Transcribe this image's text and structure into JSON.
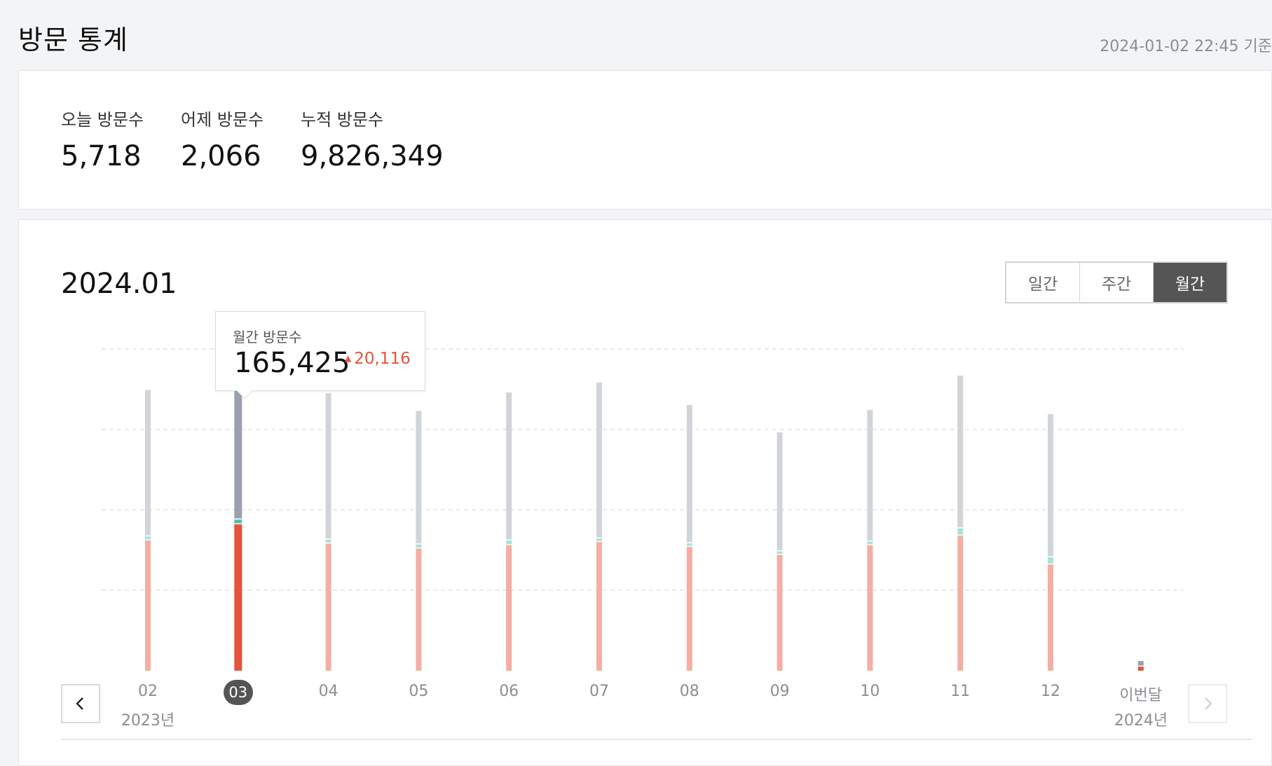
{
  "header": {
    "title": "방문 통계",
    "timestamp": "2024-01-02 22:45 기준"
  },
  "summary": [
    {
      "label": "오늘 방문수",
      "value": "5,718"
    },
    {
      "label": "어제 방문수",
      "value": "2,066"
    },
    {
      "label": "누적 방문수",
      "value": "9,826,349"
    }
  ],
  "chart_panel": {
    "period": "2024.01",
    "tabs": [
      {
        "label": "일간",
        "active": false
      },
      {
        "label": "주간",
        "active": false
      },
      {
        "label": "월간",
        "active": true
      }
    ],
    "tooltip": {
      "label": "월간 방문수",
      "value": "165,425",
      "delta": "20,116",
      "delta_direction": "up"
    },
    "year_labels": {
      "left": "2023년",
      "right": "2024년"
    },
    "prev_icon": "chevron-left-icon",
    "next_icon": "chevron-right-icon"
  },
  "chart_data": {
    "type": "bar",
    "stacked": true,
    "categories": [
      "02",
      "03",
      "04",
      "05",
      "06",
      "07",
      "08",
      "09",
      "10",
      "11",
      "12",
      "이번달"
    ],
    "selected_index": 1,
    "y_max": 200000,
    "grid_lines": 4,
    "series": [
      {
        "values": [
          81000,
          91000,
          79000,
          76000,
          78000,
          80000,
          77000,
          72000,
          78000,
          84000,
          66000,
          2500
        ],
        "color": "#e5533d"
      },
      {
        "values": [
          2500,
          3000,
          2500,
          2500,
          3000,
          2200,
          2200,
          2200,
          2200,
          4500,
          4500,
          0
        ],
        "color": "#4cc3a8"
      },
      {
        "values": [
          91000,
          102000,
          91000,
          83000,
          92000,
          97000,
          86000,
          74000,
          82000,
          95000,
          89000,
          3500
        ],
        "color": "#9aa1ad"
      }
    ],
    "colors": {
      "red_active": "#e5533d",
      "red_inactive": "#f4aea4",
      "teal_active": "#4cc3a8",
      "teal_inactive": "#a6e3d5",
      "gray_active": "#9aa1ad",
      "gray_inactive": "#d1d4d8"
    }
  }
}
